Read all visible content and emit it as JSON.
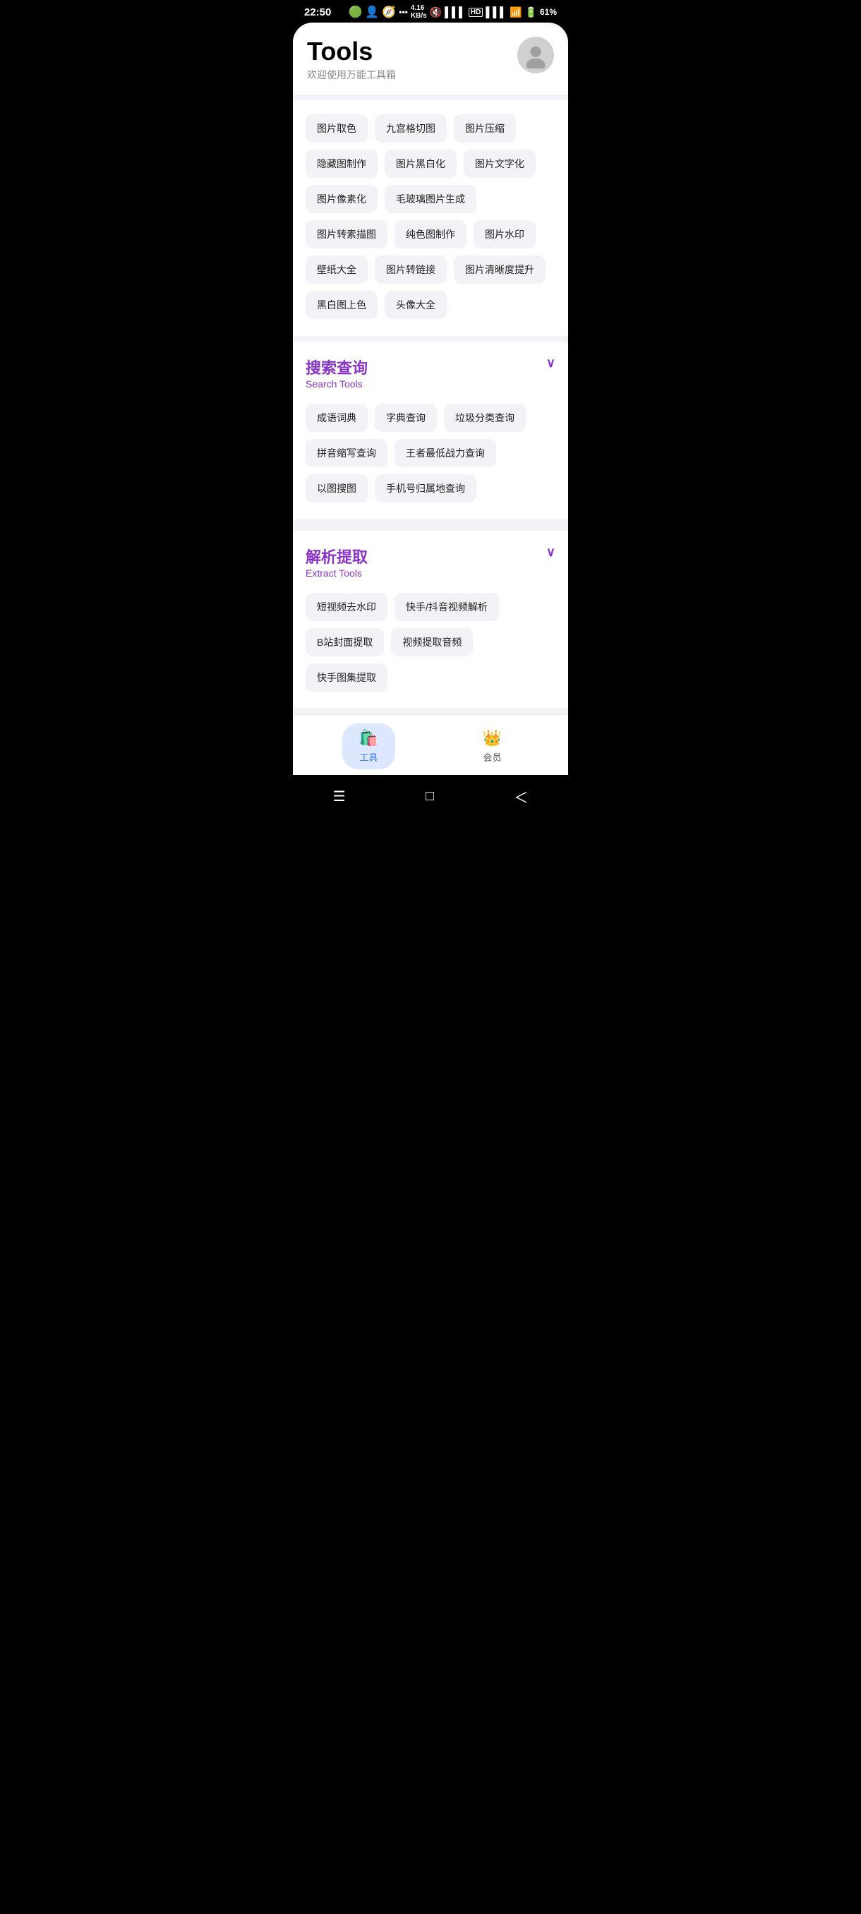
{
  "statusBar": {
    "time": "22:50",
    "rightIcons": "4.16 KB/s  🔇  ▌▌▌  HD  ▌▌▌  WiFi  🔋 61%"
  },
  "header": {
    "title": "Tools",
    "subtitle": "欢迎使用万能工具箱"
  },
  "imageSection": {
    "tools": [
      "图片取色",
      "九宫格切图",
      "图片压缩",
      "隐藏图制作",
      "图片黑白化",
      "图片文字化",
      "图片像素化",
      "毛玻璃图片生成",
      "图片转素描图",
      "纯色图制作",
      "图片水印",
      "壁纸大全",
      "图片转链接",
      "图片清晰度提升",
      "黑白图上色",
      "头像大全"
    ]
  },
  "searchSection": {
    "titleZh": "搜索查询",
    "titleEn": "Search Tools",
    "tools": [
      "成语词典",
      "字典查询",
      "垃圾分类查询",
      "拼音缩写查询",
      "王者最低战力查询",
      "以图搜图",
      "手机号归属地查询"
    ]
  },
  "extractSection": {
    "titleZh": "解析提取",
    "titleEn": "Extract Tools",
    "tools": [
      "短视频去水印",
      "快手/抖音视频解析",
      "B站封面提取",
      "视频提取音频",
      "快手图集提取"
    ]
  },
  "bottomNav": {
    "items": [
      {
        "label": "工具",
        "active": true
      },
      {
        "label": "会员",
        "active": false
      }
    ]
  },
  "systemNav": {
    "menu": "☰",
    "home": "□",
    "back": "＜"
  }
}
